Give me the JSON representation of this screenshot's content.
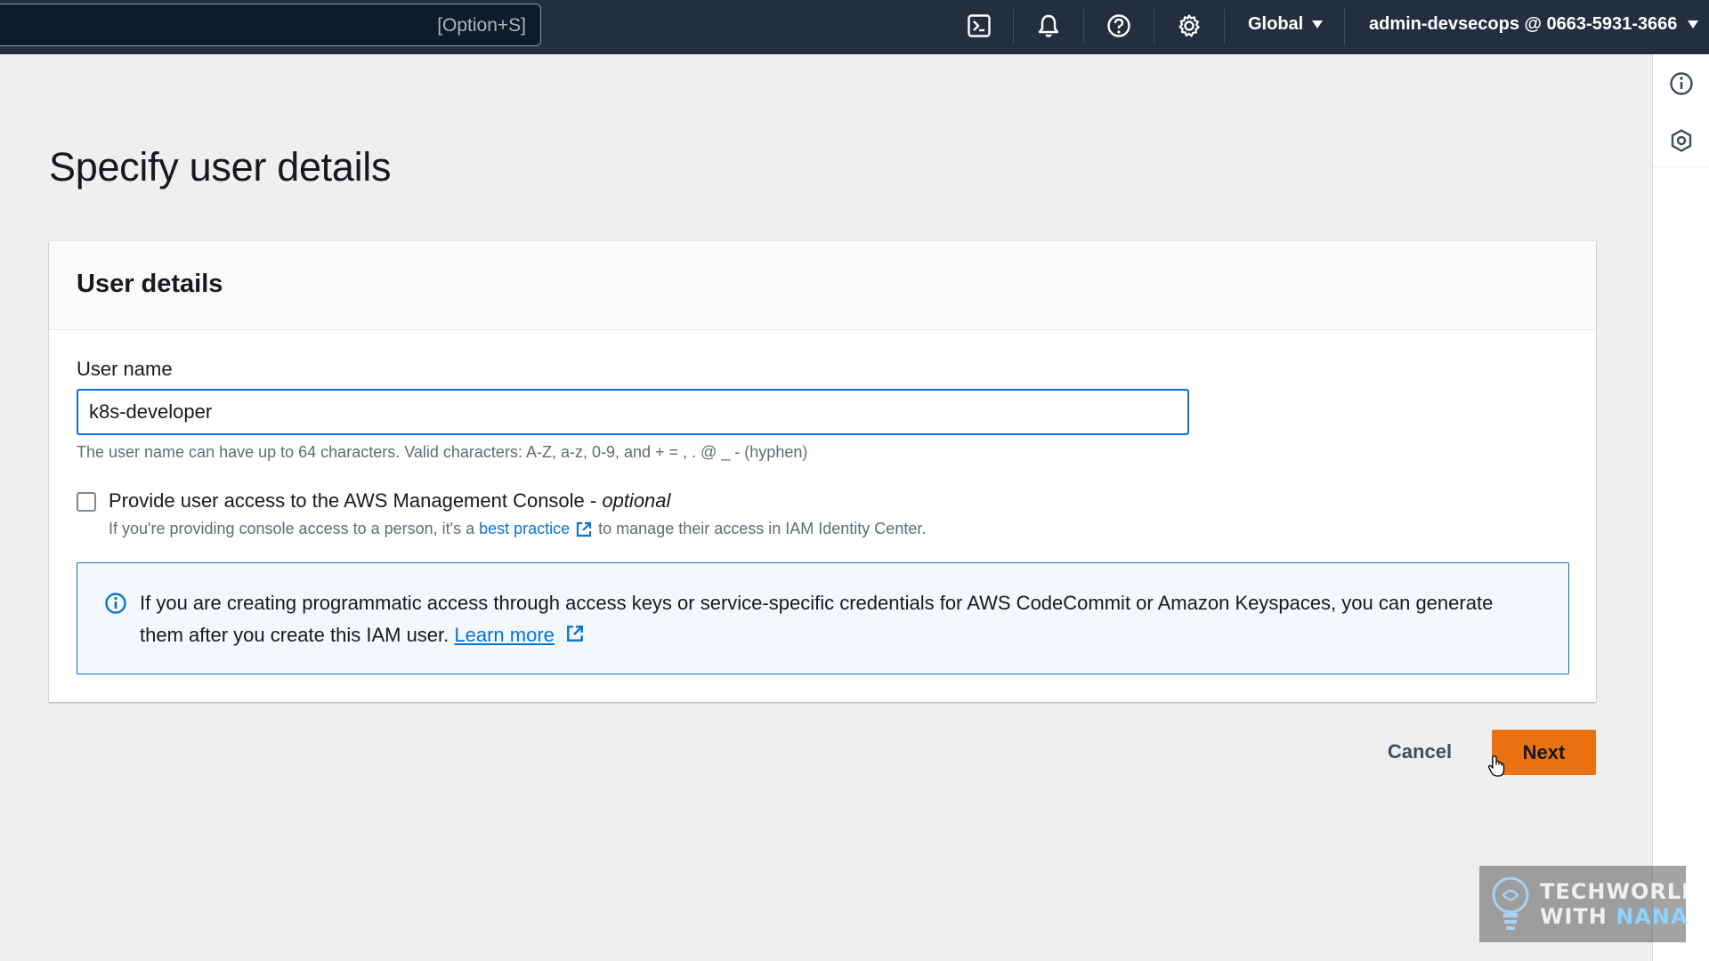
{
  "topbar": {
    "search_shortcut": "[Option+S]",
    "icons": [
      "cloudshell-icon",
      "bell-icon",
      "help-icon",
      "gear-icon"
    ],
    "region_label": "Global",
    "account_label": "admin-devsecops @ 0663-5931-3666"
  },
  "page": {
    "title": "Specify user details"
  },
  "card": {
    "title": "User details",
    "username_label": "User name",
    "username_value": "k8s-developer",
    "username_constraint": "The user name can have up to 64 characters. Valid characters: A-Z, a-z, 0-9, and + = , . @ _ - (hyphen)",
    "console_access": {
      "label": "Provide user access to the AWS Management Console - ",
      "label_optional": "optional",
      "checked": false,
      "desc_before": "If you're providing console access to a person, it's a ",
      "desc_link": "best practice",
      "desc_after": "to manage their access in IAM Identity Center."
    },
    "info": {
      "text": "If you are creating programmatic access through access keys or service-specific credentials for AWS CodeCommit or Amazon Keyspaces, you can generate them after you create this IAM user. ",
      "link": "Learn more"
    }
  },
  "actions": {
    "cancel_label": "Cancel",
    "next_label": "Next"
  },
  "watermark": {
    "line1": "TECHWORLD",
    "line2_prefix": "WITH ",
    "line2_accent": "NANA"
  },
  "colors": {
    "topbar": "#232f3e",
    "primary_button": "#ec7211",
    "link": "#0972d3",
    "info_bg": "#f2f8fd"
  }
}
